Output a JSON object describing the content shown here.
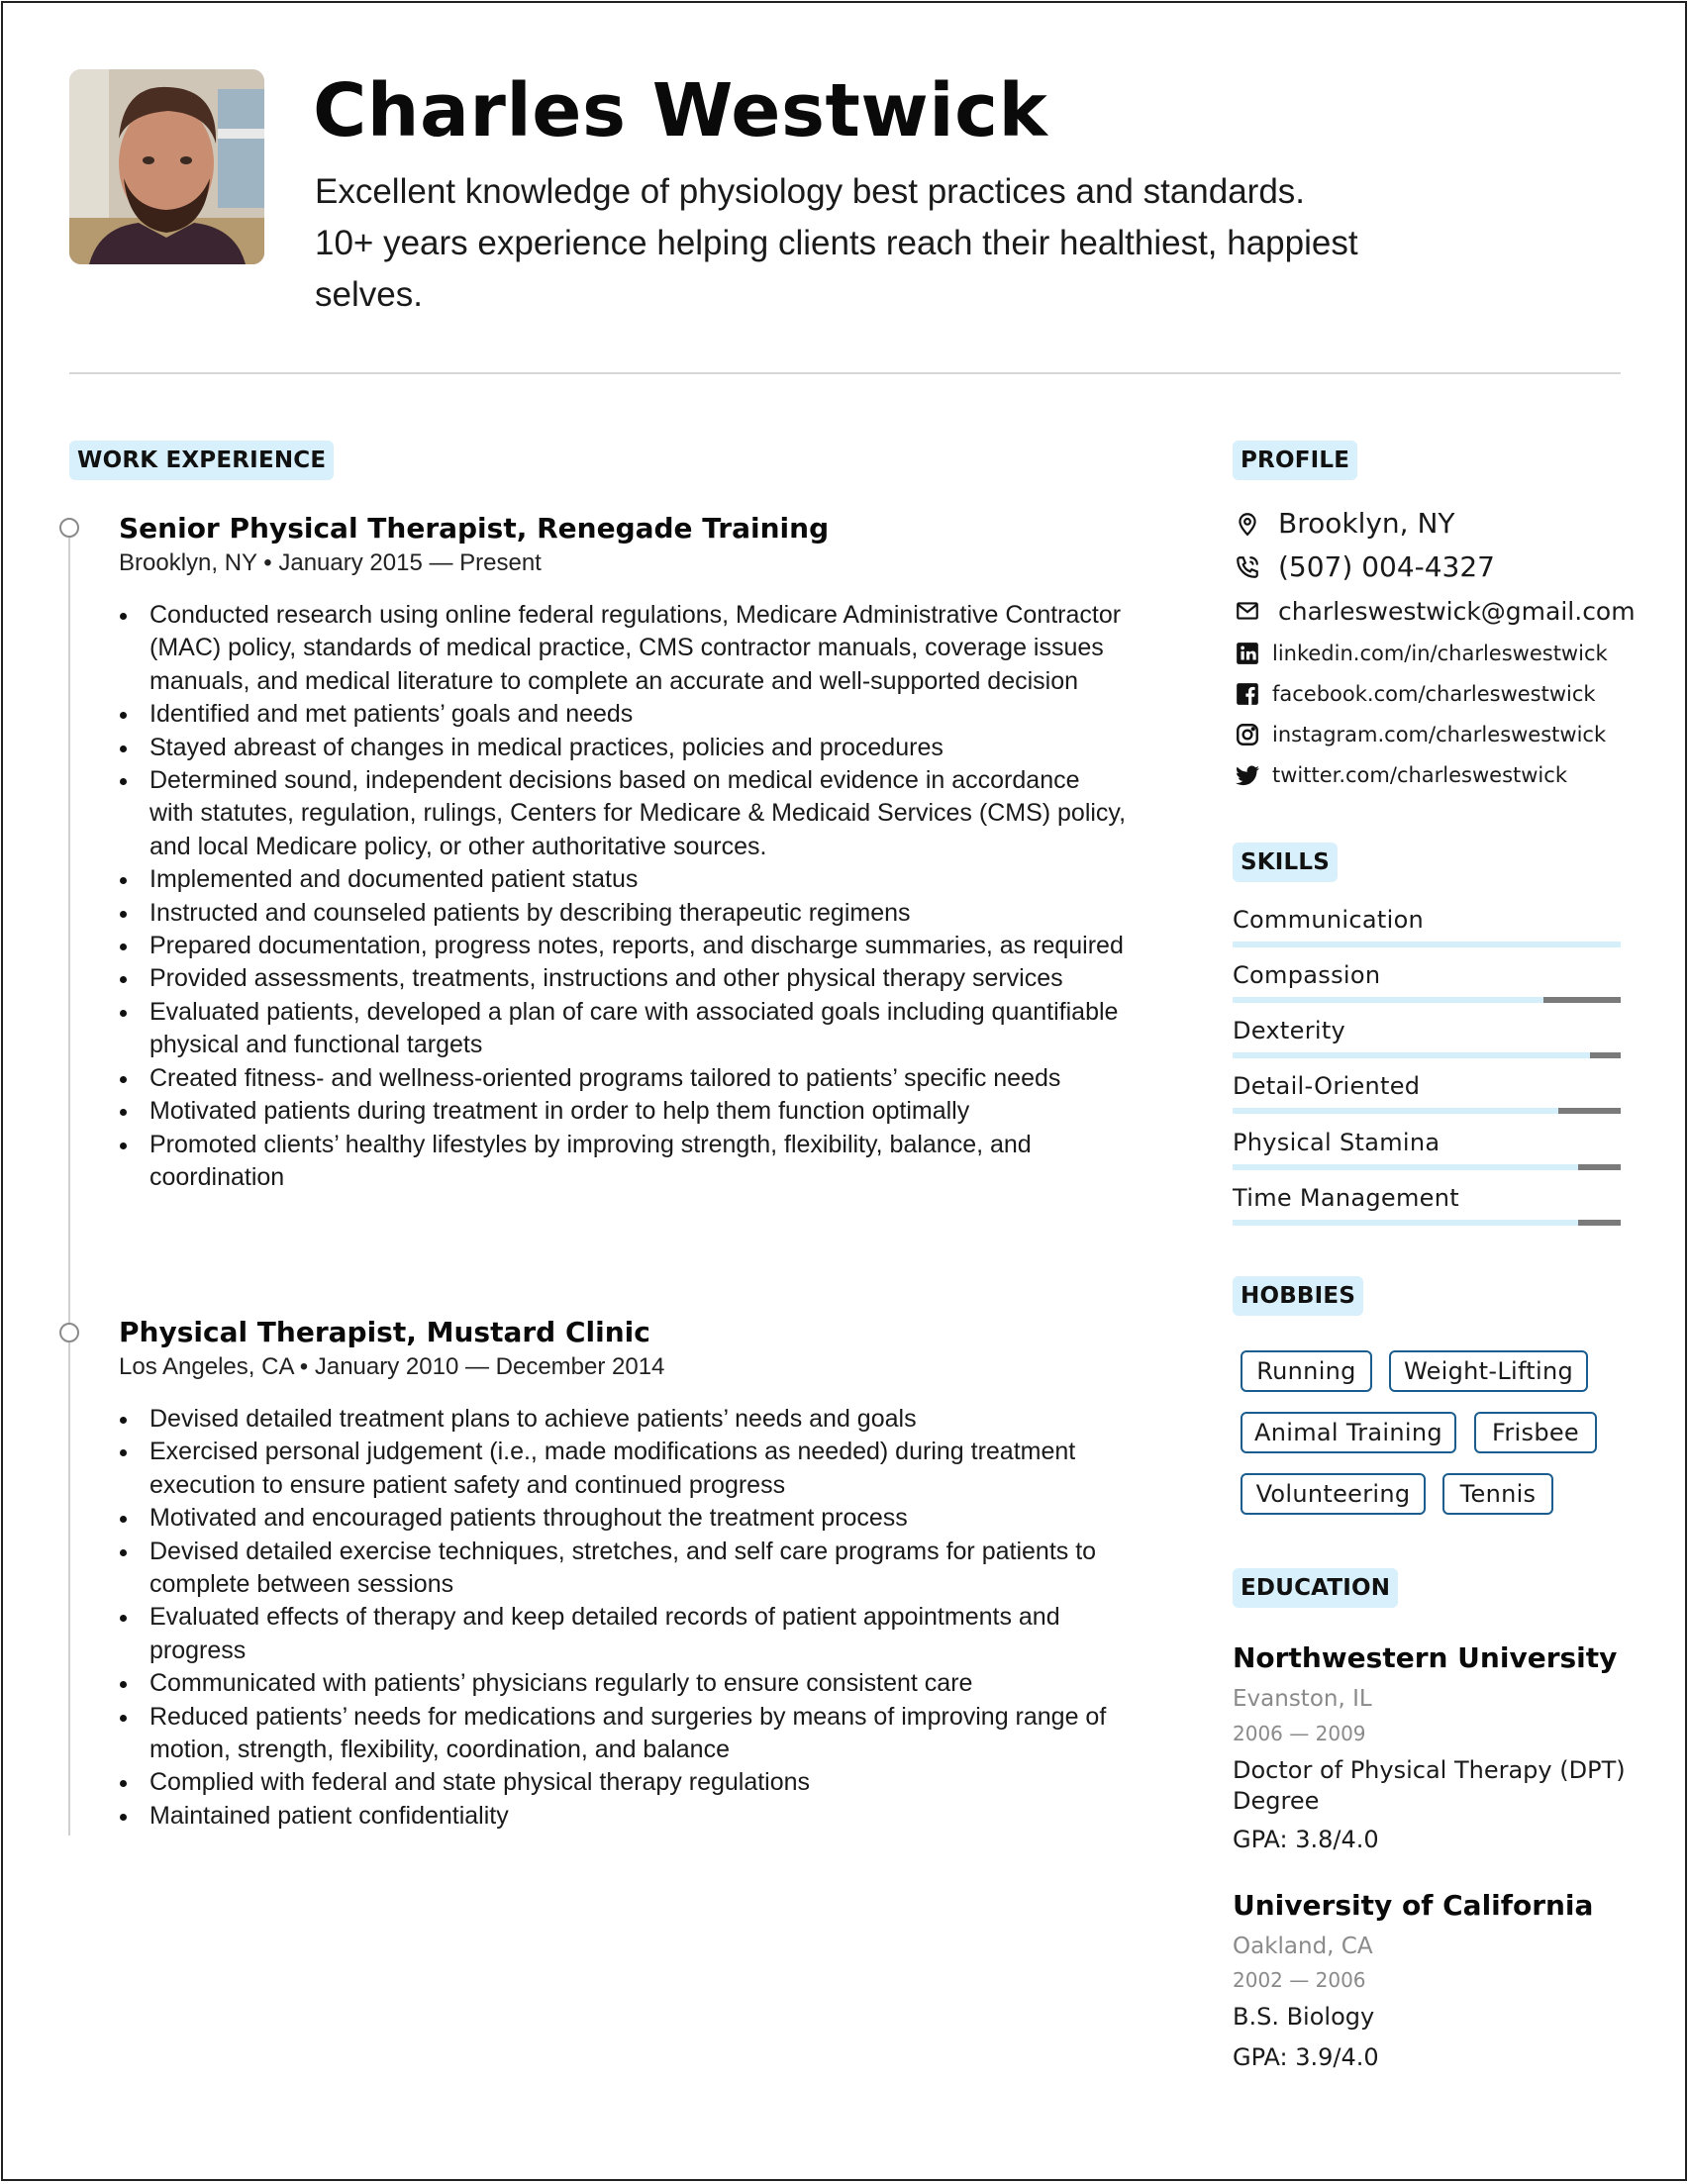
{
  "header": {
    "name": "Charles Westwick",
    "summary_lines": [
      "Excellent knowledge of physiology best practices and standards.",
      "10+ years experience helping clients reach their healthiest, happiest",
      "selves."
    ]
  },
  "work": {
    "heading": "WORK EXPERIENCE",
    "jobs": [
      {
        "title": "Senior Physical Therapist, Renegade Training",
        "meta": "Brooklyn, NY • January 2015 — Present",
        "bullets": [
          "Conducted research using online federal regulations, Medicare Administrative Contractor (MAC) policy, standards of medical practice, CMS contractor manuals, coverage issues manuals, and medical literature to complete an accurate and well-supported decision",
          "Identified and met patients’ goals and needs",
          "Stayed abreast of changes in medical practices, policies and procedures",
          "Determined sound, independent decisions based on medical evidence in accordance with statutes, regulation, rulings, Centers for Medicare & Medicaid Services (CMS) policy, and local Medicare policy, or other authoritative sources.",
          "Implemented and documented patient status",
          "Instructed and counseled patients by describing therapeutic regimens",
          "Prepared documentation, progress notes, reports, and discharge summaries, as required",
          "Provided assessments, treatments, instructions and other physical therapy services",
          "Evaluated patients, developed a plan of care with associated goals including quantifiable physical and functional targets",
          "Created fitness- and wellness-oriented programs tailored to patients’ specific needs",
          "Motivated patients during treatment in order to help them function optimally",
          "Promoted clients’ healthy lifestyles by improving strength, flexibility, balance, and coordination"
        ]
      },
      {
        "title": "Physical Therapist, Mustard Clinic",
        "meta": "Los Angeles, CA • January 2010 — December 2014",
        "bullets": [
          "Devised detailed treatment plans to achieve patients’ needs and goals",
          "Exercised personal judgement (i.e., made modifications as needed) during treatment execution to ensure patient safety and continued progress",
          "Motivated and encouraged patients throughout the treatment process",
          "Devised detailed exercise techniques, stretches, and self care programs for patients to complete between sessions",
          "Evaluated effects of therapy and keep detailed records of patient appointments and progress",
          "Communicated with patients’ physicians regularly to ensure consistent care",
          "Reduced patients’ needs for medications and surgeries by means of improving range of motion, strength, flexibility, coordination, and balance",
          "Complied with federal and state physical therapy regulations",
          "Maintained patient confidentiality"
        ]
      }
    ]
  },
  "profile": {
    "heading": "PROFILE",
    "location": "Brooklyn, NY",
    "phone": "(507) 004-4327",
    "email": "charleswestwick@gmail.com",
    "linkedin": "linkedin.com/in/charleswestwick",
    "facebook": "facebook.com/charleswestwick",
    "instagram": "instagram.com/charleswestwick",
    "twitter": "twitter.com/charleswestwick",
    "icons": [
      "map-pin-icon",
      "phone-icon",
      "mail-icon",
      "linkedin-icon",
      "facebook-icon",
      "instagram-icon",
      "twitter-icon"
    ]
  },
  "skills": {
    "heading": "SKILLS",
    "items": [
      {
        "label": "Communication",
        "level": 1.0
      },
      {
        "label": "Compassion",
        "level": 0.8
      },
      {
        "label": "Dexterity",
        "level": 0.92
      },
      {
        "label": "Detail-Oriented",
        "level": 0.84
      },
      {
        "label": "Physical Stamina",
        "level": 0.89
      },
      {
        "label": "Time Management",
        "level": 0.89
      }
    ]
  },
  "hobbies": {
    "heading": "HOBBIES",
    "items": [
      "Running",
      "Weight-Lifting",
      "Animal Training",
      "Frisbee",
      "Volunteering",
      "Tennis"
    ]
  },
  "education": {
    "heading": "EDUCATION",
    "items": [
      {
        "school": "Northwestern University",
        "location": "Evanston, IL",
        "years": "2006 — 2009",
        "degree_lines": [
          "Doctor of Physical Therapy (DPT)",
          "Degree"
        ],
        "gpa": "GPA: 3.8/4.0"
      },
      {
        "school": "University of California",
        "location": "Oakland, CA",
        "years": "2002 — 2006",
        "degree_lines": [
          "B.S. Biology"
        ],
        "gpa": "GPA: 3.9/4.0"
      }
    ]
  },
  "colors": {
    "badge_bg": "#d7f0fb",
    "skill_fill": "#d4eefa",
    "skill_track": "#7a7a7a",
    "chip_border": "#1b5d8e",
    "muted_text": "#8a8a8a"
  }
}
